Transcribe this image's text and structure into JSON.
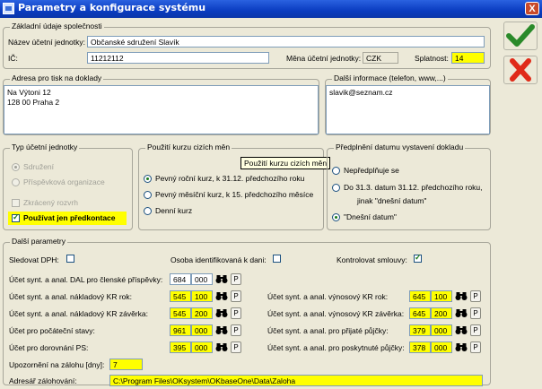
{
  "window": {
    "title": "Parametry a konfigurace systému",
    "close": "X"
  },
  "basic": {
    "legend": "Základní údaje společnosti",
    "name_label": "Název účetní jednotky:",
    "name_value": "Občanské sdružení Slavík",
    "ic_label": "IČ:",
    "ic_value": "11212112",
    "currency_label": "Měna účetní jednotky:",
    "currency_value": "CZK",
    "due_label": "Splatnost:",
    "due_value": "14"
  },
  "address": {
    "legend": "Adresa pro tisk na doklady",
    "line1": "Na Výtoni 12",
    "line2": "128 00 Praha 2"
  },
  "info": {
    "legend": "Další informace (telefon, www,...)",
    "value": "slavik@seznam.cz"
  },
  "unit_type": {
    "legend": "Typ účetní jednotky",
    "opt1": "Sdružení",
    "opt2": "Příspěvková organizace",
    "chk1": "Zkrácený rozvrh",
    "chk2": "Používat jen předkontace"
  },
  "rates": {
    "legend": "Použití kurzu cizích měn",
    "tooltip": "Použití kurzu cizích měn",
    "opt1": "Pevný roční kurz, k 31.12. předchozího roku",
    "opt2": "Pevný měsíční kurz, k 15. předchozího měsíce",
    "opt3": "Denní kurz"
  },
  "prefill": {
    "legend": "Předplnění datumu vystavení dokladu",
    "opt1": "Nepředplňuje se",
    "opt2a": "Do 31.3. datum 31.12. předchozího roku,",
    "opt2b": "jinak \"dnešní datum\"",
    "opt3": "\"Dnešní datum\""
  },
  "params": {
    "legend": "Další parametry",
    "vat_label": "Sledovat DPH:",
    "ident_label": "Osoba identifikovaná k dani:",
    "contracts_label": "Kontrolovat smlouvy:",
    "p_label": "P",
    "rows_left": [
      {
        "label": "Účet synt. a anal. DAL pro členské příspěvky:",
        "synt": "684",
        "anal": "000"
      },
      {
        "label": "Účet synt. a anal. nákladový KR rok:",
        "synt": "545",
        "anal": "100"
      },
      {
        "label": "Účet synt. a anal. nákladový KR závěrka:",
        "synt": "545",
        "anal": "200"
      },
      {
        "label": "Účet pro počáteční stavy:",
        "synt": "961",
        "anal": "000"
      },
      {
        "label": "Účet pro dorovnání PS:",
        "synt": "395",
        "anal": "000"
      }
    ],
    "rows_right": [
      {
        "label": "Účet synt. a anal. výnosový KR rok:",
        "synt": "645",
        "anal": "100"
      },
      {
        "label": "Účet synt. a anal. výnosový KR závěrka:",
        "synt": "645",
        "anal": "200"
      },
      {
        "label": "Účet synt. a anal. pro přijaté půjčky:",
        "synt": "379",
        "anal": "000"
      },
      {
        "label": "Účet synt. a anal. pro poskytnuté půjčky:",
        "synt": "378",
        "anal": "000"
      }
    ],
    "advance_label": "Upozornění na zálohu [dny]:",
    "advance_value": "7",
    "backup_label": "Adresář zálohování:",
    "backup_value": "C:\\Program Files\\OKsystem\\OKbaseOne\\Data\\Zaloha"
  }
}
